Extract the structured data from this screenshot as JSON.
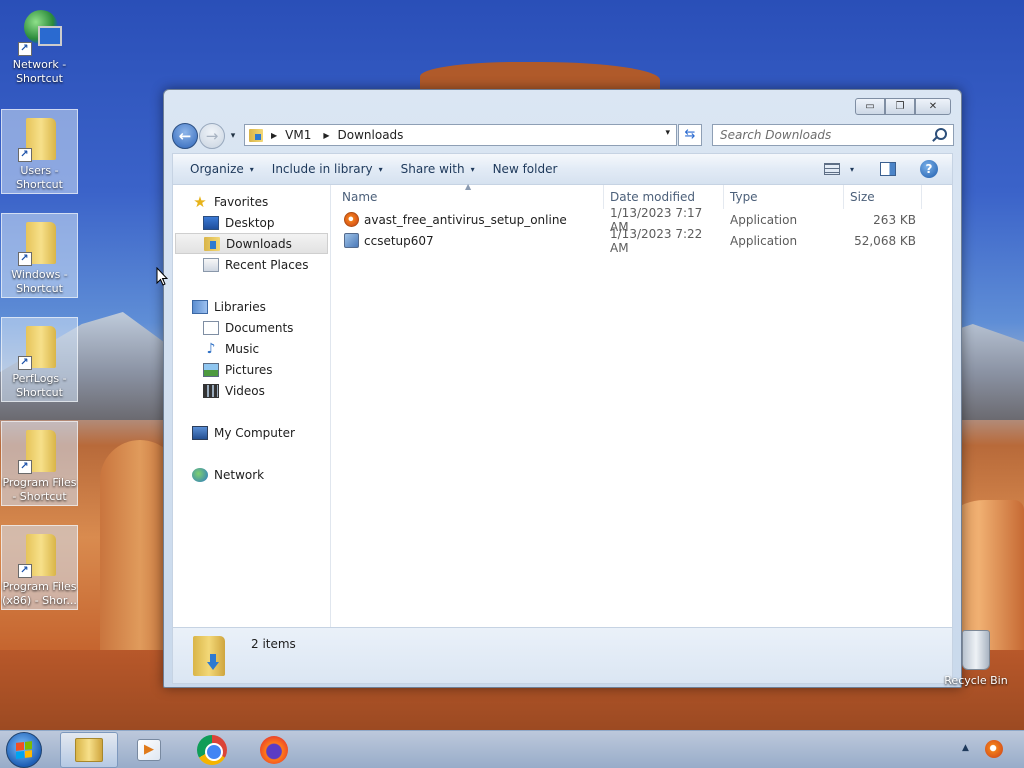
{
  "desktop": {
    "icons": [
      {
        "label": "Network - Shortcut",
        "icon": "network-icon"
      },
      {
        "label": "Users - Shortcut",
        "icon": "folder-icon"
      },
      {
        "label": "Windows - Shortcut",
        "icon": "folder-icon"
      },
      {
        "label": "PerfLogs - Shortcut",
        "icon": "folder-icon"
      },
      {
        "label": "Program Files - Shortcut",
        "icon": "folder-icon"
      },
      {
        "label": "Program Files (x86) - Shor...",
        "icon": "folder-icon"
      }
    ],
    "recycle_bin": "Recycle Bin"
  },
  "window": {
    "controls": {
      "minimize": "▭",
      "maximize": "❐",
      "close": "✕"
    },
    "nav": {
      "back": "←",
      "forward": "→",
      "history": "▾"
    },
    "address": {
      "segments": [
        "VM1",
        "Downloads"
      ],
      "dropdown": "▾"
    },
    "refresh": "⇆",
    "search": {
      "placeholder": "Search Downloads"
    },
    "toolbar": {
      "organize": "Organize",
      "include_in_library": "Include in library",
      "share_with": "Share with",
      "new_folder": "New folder",
      "caret": "▾"
    },
    "nav_pane": {
      "favorites": "Favorites",
      "desktop": "Desktop",
      "downloads": "Downloads",
      "recent_places": "Recent Places",
      "libraries": "Libraries",
      "documents": "Documents",
      "music": "Music",
      "pictures": "Pictures",
      "videos": "Videos",
      "my_computer": "My Computer",
      "network": "Network"
    },
    "columns": {
      "name": "Name",
      "date_modified": "Date modified",
      "type": "Type",
      "size": "Size"
    },
    "files": [
      {
        "name": "avast_free_antivirus_setup_online",
        "date": "1/13/2023 7:17 AM",
        "type": "Application",
        "size": "263 KB"
      },
      {
        "name": "ccsetup607",
        "date": "1/13/2023 7:22 AM",
        "type": "Application",
        "size": "52,068 KB"
      }
    ],
    "details": {
      "count": "2 items"
    }
  },
  "taskbar": {
    "apps": [
      "Windows Explorer",
      "Media Player",
      "Google Chrome",
      "Firefox"
    ],
    "tray_arrow": "▲"
  },
  "colors": {
    "accent": "#1e395b",
    "window_frame": "#dbe6f3"
  }
}
